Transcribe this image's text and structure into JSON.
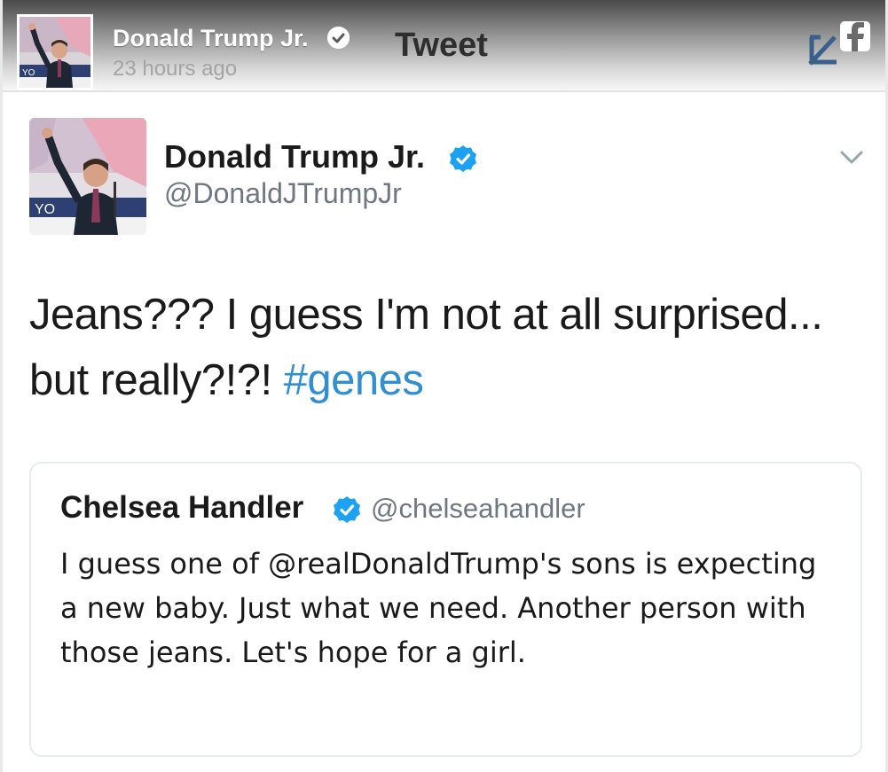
{
  "header": {
    "name": "Donald Trump Jr.",
    "time": "23 hours ago",
    "title": "Tweet",
    "verified_icon": "verified-check-icon",
    "share_icon": "facebook-share-icon"
  },
  "tweet": {
    "name": "Donald Trump Jr.",
    "handle": "@DonaldJTrumpJr",
    "text_line1": "Jeans??? I guess I'm not at all surprised...",
    "text_line2": "but really?!?! ",
    "hashtag": "#genes",
    "menu_icon": "chevron-down-icon"
  },
  "quoted_tweet": {
    "name": "Chelsea Handler",
    "handle": "@chelseahandler",
    "text": "I guess one of @realDonaldTrump's sons is expecting a new baby. Just what we need. Another person with those jeans. Let's hope for a girl."
  },
  "colors": {
    "accent": "#2f8fd1",
    "verified": "#1da1f2",
    "handle_gray": "#6e7782"
  }
}
